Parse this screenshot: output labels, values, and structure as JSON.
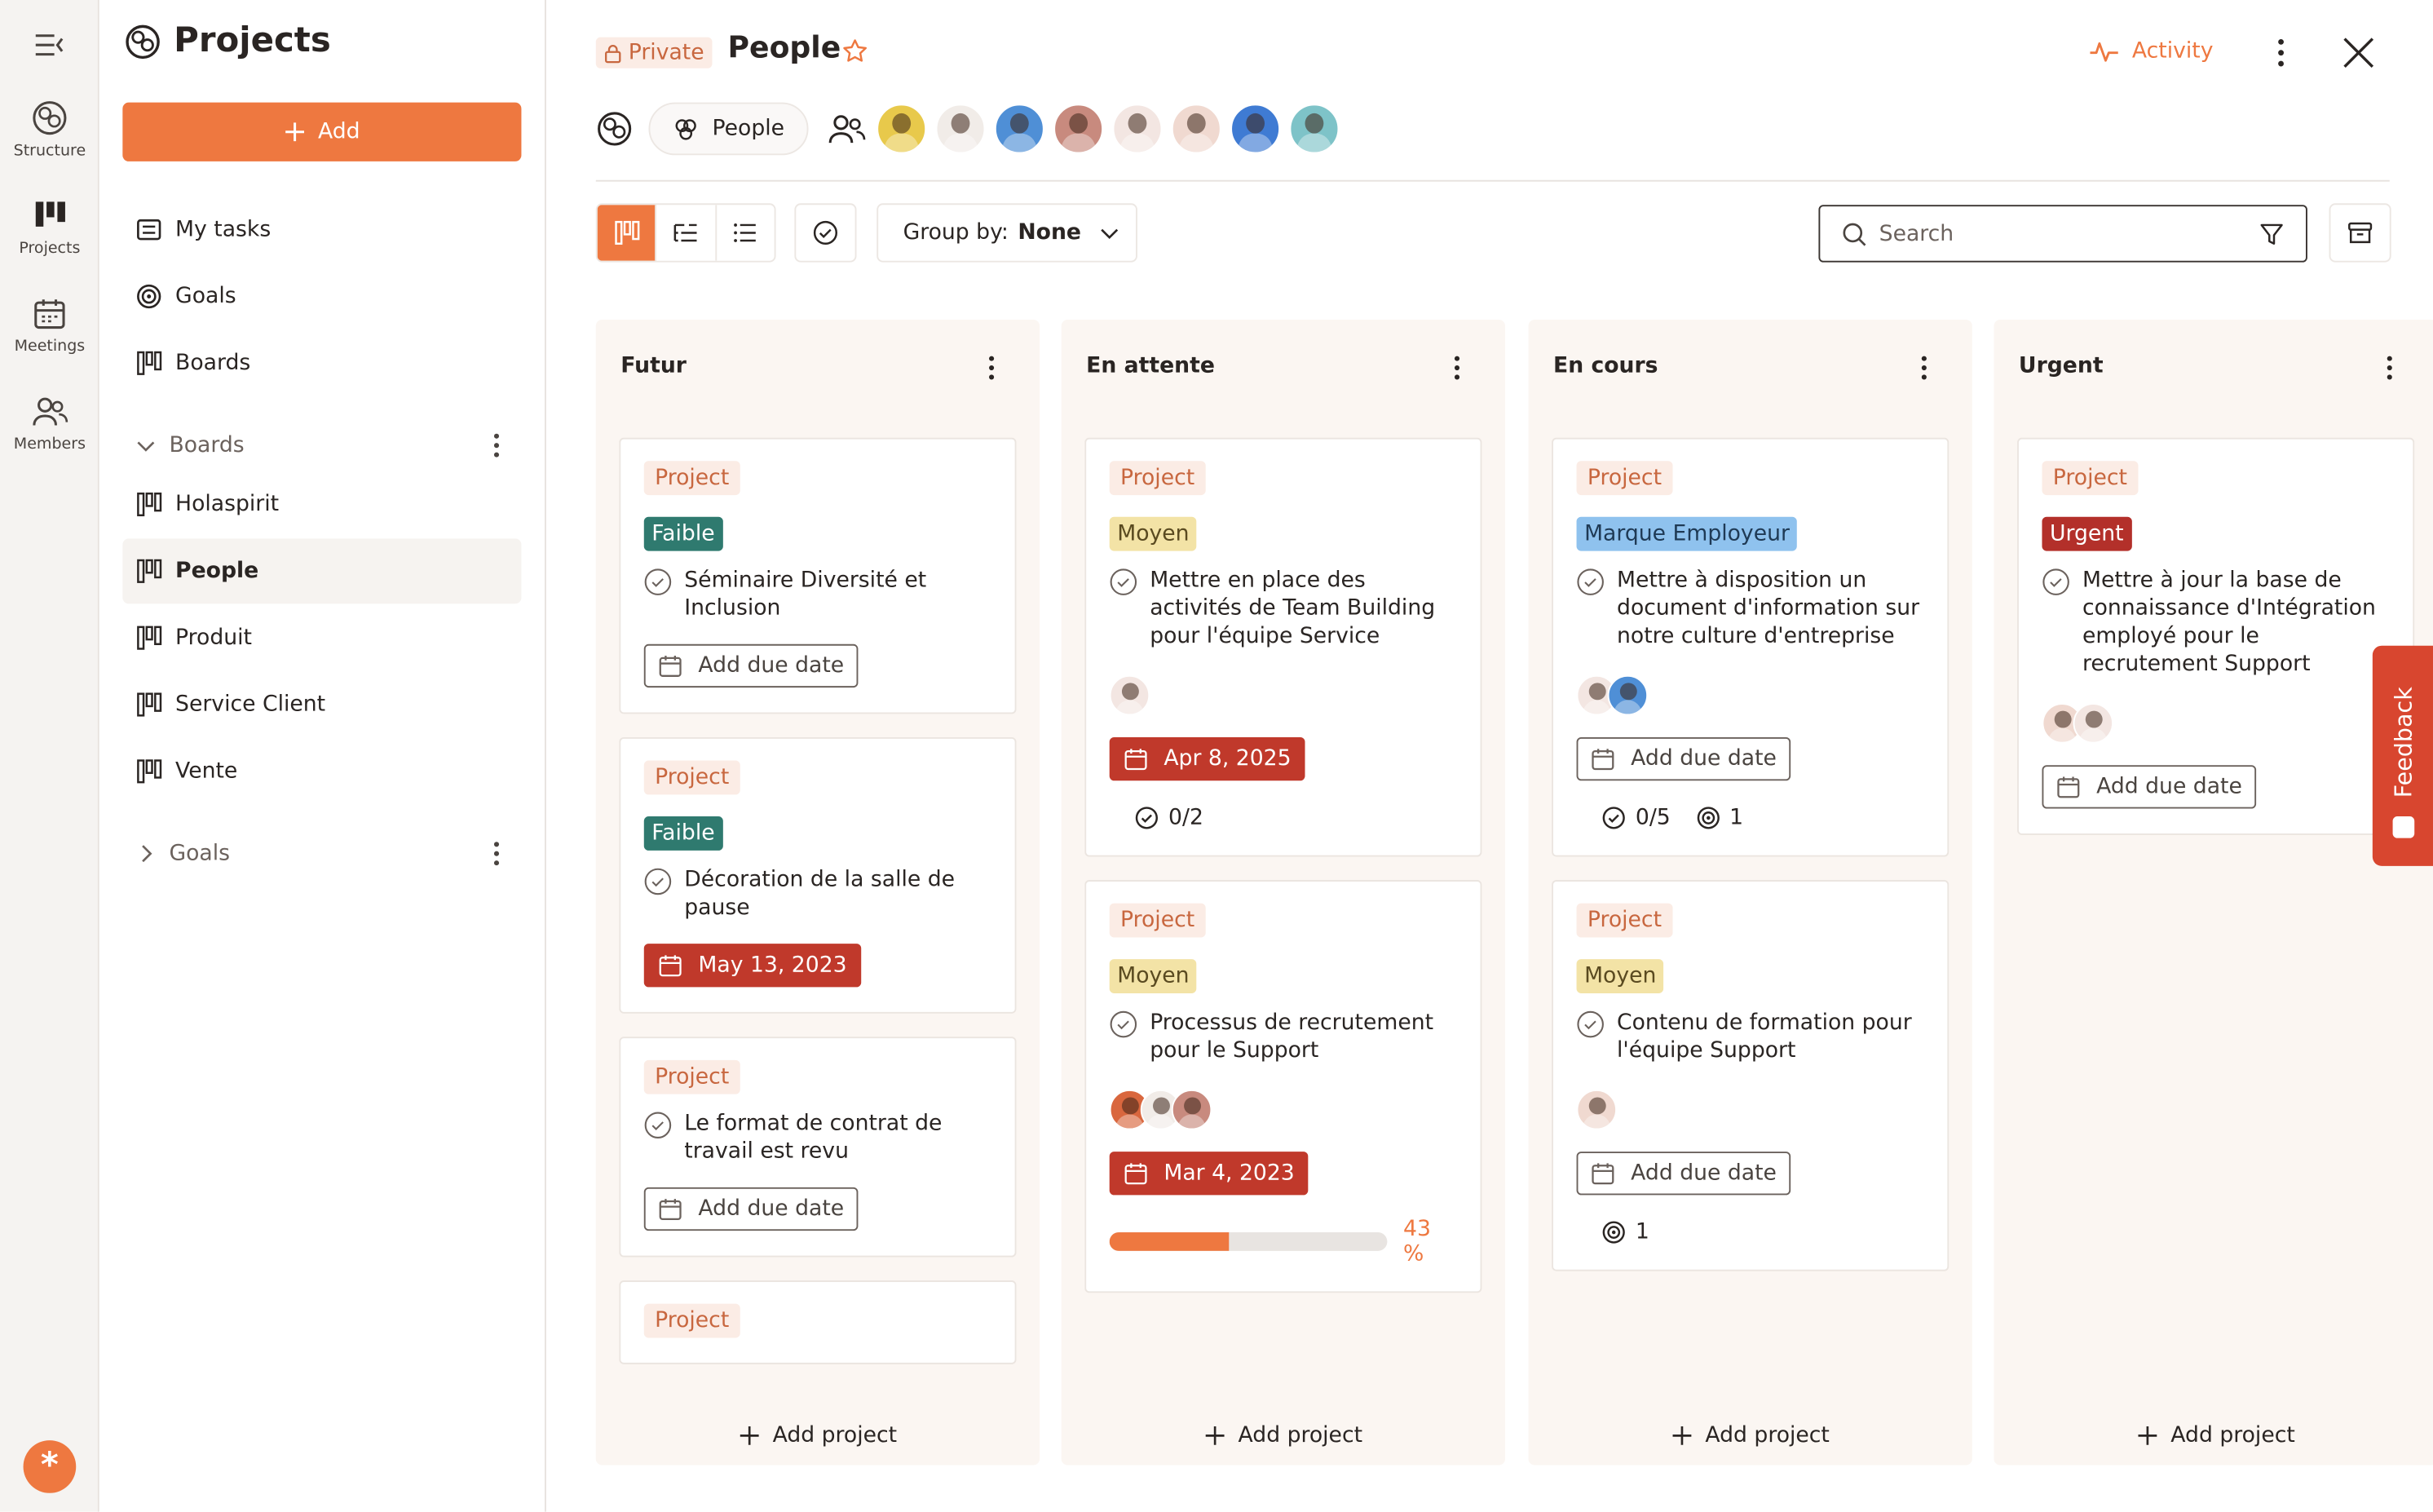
{
  "rail": {
    "items": [
      {
        "label": "Structure",
        "icon": "structure-icon"
      },
      {
        "label": "Projects",
        "icon": "projects-icon"
      },
      {
        "label": "Meetings",
        "icon": "calendar-icon"
      },
      {
        "label": "Members",
        "icon": "members-icon"
      }
    ]
  },
  "side": {
    "title": "Projects",
    "add_label": "Add",
    "nav": {
      "my_tasks": "My tasks",
      "goals": "Goals",
      "boards": "Boards"
    },
    "boards_group": "Boards",
    "boards": [
      "Holaspirit",
      "People",
      "Produit",
      "Service Client",
      "Vente"
    ],
    "goals_group": "Goals"
  },
  "header": {
    "privacy": "Private",
    "title": "People",
    "activity": "Activity",
    "circle": "People"
  },
  "toolbar": {
    "group_by_label": "Group by:",
    "group_by_value": "None",
    "search_placeholder": "Search"
  },
  "columns": [
    {
      "title": "Futur",
      "add_label": "Add project"
    },
    {
      "title": "En attente",
      "add_label": "Add project"
    },
    {
      "title": "En cours",
      "add_label": "Add project"
    },
    {
      "title": "Urgent",
      "add_label": "Add project"
    }
  ],
  "cards": {
    "c1": {
      "type": "Project",
      "priority": "Faible",
      "title": "Séminaire Diversité et Inclusion",
      "due": "Add due date"
    },
    "c2": {
      "type": "Project",
      "priority": "Faible",
      "title": "Décoration de la salle de pause",
      "due": "May 13, 2023"
    },
    "c3": {
      "type": "Project",
      "title": "Le format de contrat de travail est revu",
      "due": "Add due date"
    },
    "c4": {
      "type": "Project"
    },
    "c5": {
      "type": "Project",
      "priority": "Moyen",
      "title": "Mettre en place des activités de Team Building pour l'équipe Service",
      "due": "Apr 8, 2025",
      "tasks": "0/2"
    },
    "c6": {
      "type": "Project",
      "priority": "Moyen",
      "title": "Processus de recrutement pour le Support",
      "due": "Mar 4, 2023",
      "progress": 43,
      "progress_label": "43 %"
    },
    "c7": {
      "type": "Project",
      "priority": "Marque Employeur",
      "title": "Mettre à disposition un document d'information sur notre culture d'entreprise",
      "due": "Add due date",
      "tasks": "0/5",
      "goals": "1"
    },
    "c8": {
      "type": "Project",
      "priority": "Moyen",
      "title": "Contenu de formation pour l'équipe Support",
      "due": "Add due date",
      "goals": "1"
    },
    "c9": {
      "type": "Project",
      "priority": "Urgent",
      "title": "Mettre à jour la base de connaissance d'Intégration employé pour le recrutement Support",
      "due": "Add due date"
    }
  },
  "colors": {
    "accent": "#ee7840",
    "faible": "#2f7a6f",
    "moyen": "#f3e3a6",
    "marque": "#8fc2ee",
    "urgent": "#b3302a",
    "overdue": "#c0392b"
  },
  "feedback": "Feedback"
}
